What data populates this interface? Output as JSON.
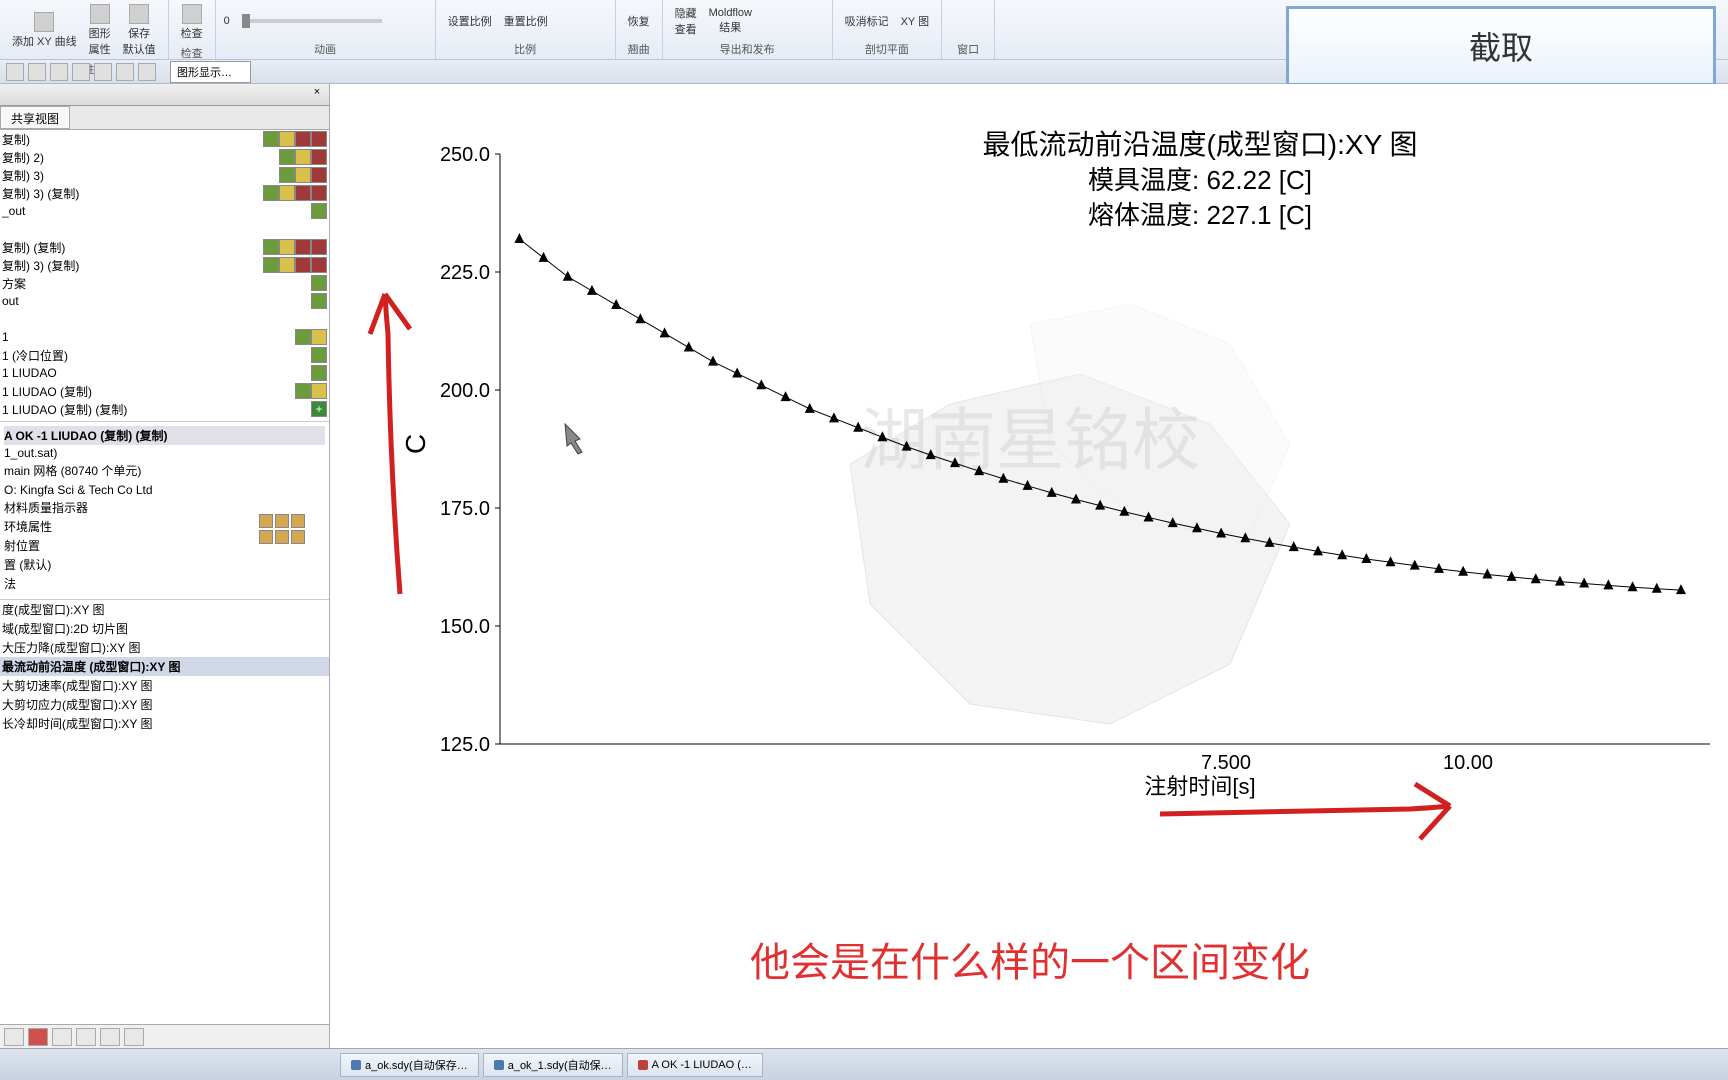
{
  "ribbon": {
    "add_xy": "添加 XY 曲线",
    "graphics": "图形",
    "props": "属性",
    "save": "保存",
    "default": "默认值",
    "check": "检查",
    "set_scale": "设置比例",
    "reset_scale": "重置比例",
    "restore": "恢复",
    "hide": "隐藏",
    "view": "查看",
    "moldflow": "Moldflow",
    "result": "结果",
    "clear_mark": "吸消标记",
    "xy_chart": "XY 图",
    "g_props": "属性",
    "g_check": "检查",
    "g_anim": "动画",
    "g_scale": "比例",
    "g_warp": "翘曲",
    "g_export": "导出和发布",
    "g_section": "剖切平面",
    "g_window": "窗口"
  },
  "qat_dropdown": "图形显示…",
  "screenshot": "截取",
  "panel": {
    "tab": "共享视图",
    "layers": [
      "复制)",
      "复制) 2)",
      "复制) 3)",
      "复制) 3) (复制)",
      "_out",
      "",
      "复制) (复制)",
      "复制) 3) (复制)",
      "方案",
      "out",
      "",
      "1",
      "1 (冷口位置)",
      "1 LIUDAO",
      "1 LIUDAO (复制)",
      "1 LIUDAO (复制) (复制)"
    ],
    "info_title": "A OK -1 LIUDAO (复制) (复制)",
    "info_rows": [
      "1_out.sat)",
      "main 网格 (80740 个单元)",
      "",
      "O: Kingfa Sci & Tech Co Ltd",
      "材料质量指示器",
      "环境属性",
      "射位置",
      "置 (默认)",
      "法",
      ""
    ],
    "results": [
      "度(成型窗口):XY 图",
      "域(成型窗口):2D 切片图",
      "大压力降(成型窗口):XY 图",
      "最流动前沿温度 (成型窗口):XY 图",
      "大剪切速率(成型窗口):XY 图",
      "大剪切应力(成型窗口):XY 图",
      "长冷却时间(成型窗口):XY 图"
    ]
  },
  "chart_data": {
    "type": "line",
    "title": "最低流动前沿温度(成型窗口):XY 图",
    "sub1": "模具温度: 62.22 [C]",
    "sub2": "熔体温度: 227.1 [C]",
    "xlabel": "注射时间[s]",
    "ylabel": "C",
    "ylim": [
      125.0,
      250.0
    ],
    "xlim": [
      0,
      12.5
    ],
    "yticks": [
      "125.0",
      "150.0",
      "175.0",
      "200.0",
      "225.0",
      "250.0"
    ],
    "xticks_visible": [
      "7.500",
      "10.00"
    ],
    "x": [
      0.2,
      0.45,
      0.7,
      0.95,
      1.2,
      1.45,
      1.7,
      1.95,
      2.2,
      2.45,
      2.7,
      2.95,
      3.2,
      3.45,
      3.7,
      3.95,
      4.2,
      4.45,
      4.7,
      4.95,
      5.2,
      5.45,
      5.7,
      5.95,
      6.2,
      6.45,
      6.7,
      6.95,
      7.2,
      7.45,
      7.7,
      7.95,
      8.2,
      8.45,
      8.7,
      8.95,
      9.2,
      9.45,
      9.7,
      9.95,
      10.2,
      10.45,
      10.7,
      10.95,
      11.2,
      11.45,
      11.7,
      11.95,
      12.2
    ],
    "values": [
      232,
      228,
      224,
      221,
      218,
      215,
      212,
      209,
      206,
      203.5,
      201,
      198.5,
      196,
      194,
      192,
      190,
      188,
      186.2,
      184.5,
      182.8,
      181.2,
      179.7,
      178.2,
      176.8,
      175.5,
      174.2,
      173,
      171.8,
      170.7,
      169.6,
      168.6,
      167.6,
      166.7,
      165.8,
      165,
      164.2,
      163.5,
      162.8,
      162.1,
      161.5,
      160.9,
      160.4,
      159.9,
      159.4,
      159,
      158.6,
      158.2,
      157.9,
      157.6
    ]
  },
  "watermark": "湖南星铭校",
  "subtitle_overlay": "他会是在什么样的一个区间变化",
  "taskbar": {
    "items": [
      "a_ok.sdy(自动保存…",
      "a_ok_1.sdy(自动保…",
      "A OK -1 LIUDAO (…"
    ]
  }
}
